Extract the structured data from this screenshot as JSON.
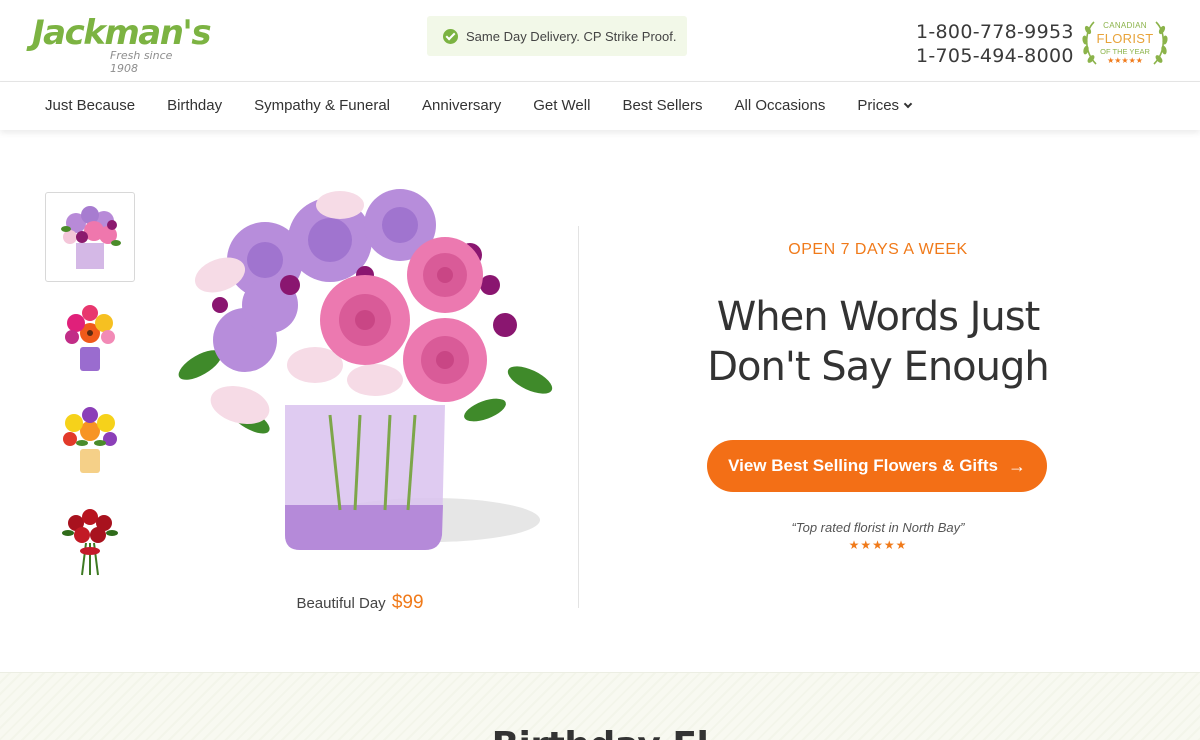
{
  "header": {
    "logo_text": "Jackman's",
    "logo_tagline": "Fresh since 1908",
    "delivery_notice": "Same Day Delivery. CP Strike Proof.",
    "phones": [
      "1-800-778-9953",
      "1-705-494-8000"
    ],
    "award": {
      "line1": "CANADIAN",
      "line2": "FLORIST",
      "line3": "OF THE YEAR",
      "stars": "★★★★★"
    }
  },
  "nav": {
    "items": [
      "Just Because",
      "Birthday",
      "Sympathy & Funeral",
      "Anniversary",
      "Get Well",
      "Best Sellers",
      "All Occasions",
      "Prices"
    ]
  },
  "hero": {
    "product_name": "Beautiful Day",
    "product_price": "$99",
    "eyebrow": "OPEN 7 DAYS A WEEK",
    "headline_line1": "When Words Just",
    "headline_line2": "Don't Say Enough",
    "cta_label": "View Best Selling Flowers & Gifts",
    "cta_arrow": "→",
    "quote": "“Top rated florist in North Bay”",
    "rating_stars": "★★★★★",
    "thumbnails": [
      "pink-purple-bouquet-thumb",
      "gerbera-bouquet-thumb",
      "yellow-lily-bouquet-thumb",
      "red-roses-bouquet-thumb"
    ]
  },
  "section": {
    "title": "Birthday Fl"
  },
  "colors": {
    "brand_green": "#7cb342",
    "accent_orange": "#f36f16",
    "text_dark": "#333333"
  }
}
